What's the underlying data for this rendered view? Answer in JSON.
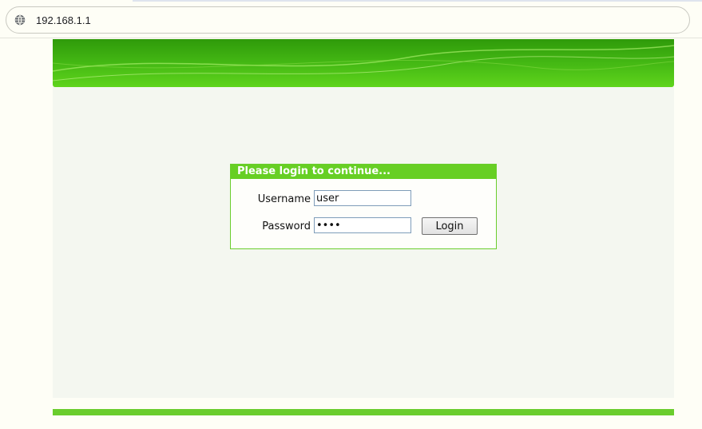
{
  "browser": {
    "url": "192.168.1.1",
    "address_icon": "globe-icon"
  },
  "login": {
    "title": "Please login to continue...",
    "username_label": "Username",
    "username_value": "user",
    "password_label": "Password",
    "password_value": "••••",
    "login_button": "Login"
  },
  "theme": {
    "banner_dark": "#2f9a0a",
    "banner_light": "#5fd41c",
    "accent": "#67cf24",
    "content_bg": "#f4f7f0"
  }
}
